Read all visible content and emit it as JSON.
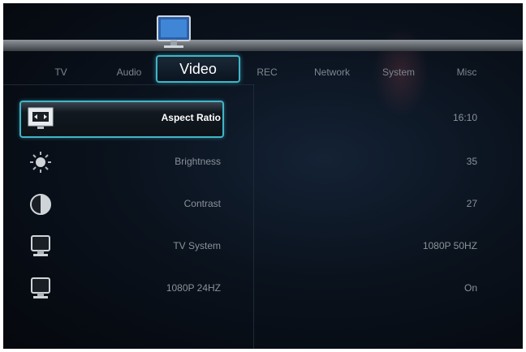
{
  "tabs": [
    {
      "label": "TV"
    },
    {
      "label": "Audio"
    },
    {
      "label": "Video",
      "active": true
    },
    {
      "label": "REC"
    },
    {
      "label": "Network"
    },
    {
      "label": "System"
    },
    {
      "label": "Misc"
    }
  ],
  "settings": [
    {
      "label": "Aspect Ratio",
      "value": "16:10",
      "icon": "aspect-ratio-icon",
      "selected": true
    },
    {
      "label": "Brightness",
      "value": "35",
      "icon": "brightness-icon"
    },
    {
      "label": "Contrast",
      "value": "27",
      "icon": "contrast-icon"
    },
    {
      "label": "TV System",
      "value": "1080P 50HZ",
      "icon": "monitor-icon"
    },
    {
      "label": "1080P 24HZ",
      "value": "On",
      "icon": "monitor-icon"
    }
  ],
  "colors": {
    "accent": "#3fb6c8",
    "background": "#0a121d",
    "text": "#8a929a"
  }
}
